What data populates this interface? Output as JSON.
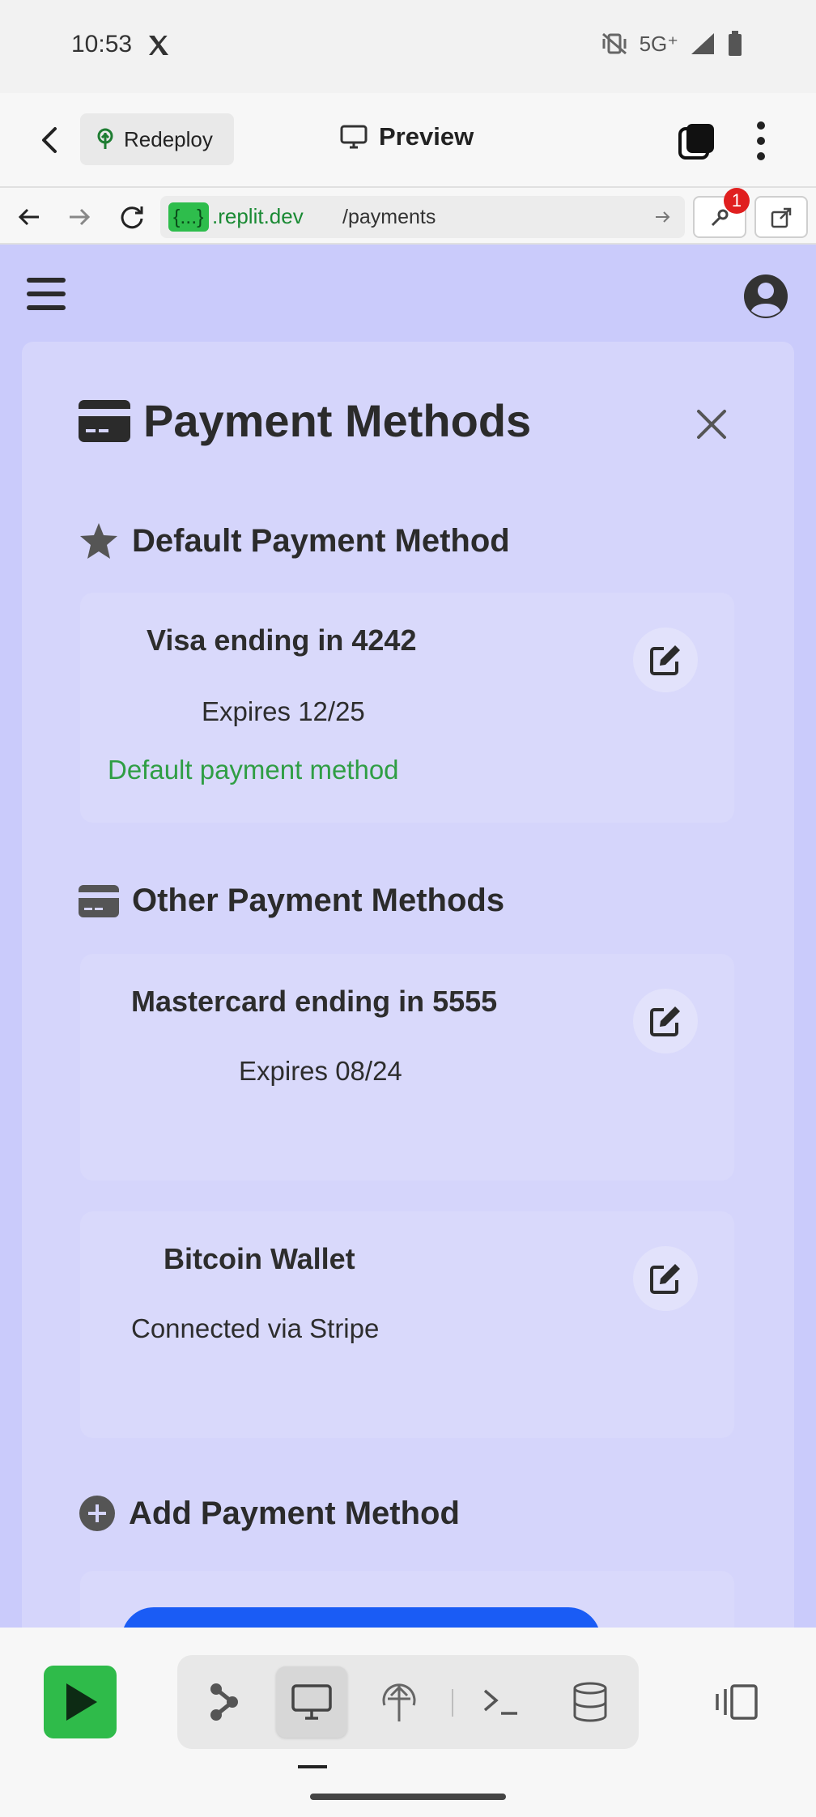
{
  "status_bar": {
    "time": "10:53",
    "network": "5G⁺"
  },
  "header": {
    "redeploy_label": "Redeploy",
    "preview_label": "Preview"
  },
  "browser": {
    "url_badge": "{...}",
    "url_host": ".replit.dev",
    "url_path": "/payments",
    "devtools_badge": "1"
  },
  "panel": {
    "title": "Payment Methods",
    "default_section": {
      "title": "Default Payment Method",
      "card": {
        "name": "Visa ending in 4242",
        "expires": "Expires 12/25",
        "default_label": "Default payment method"
      }
    },
    "other_section": {
      "title": "Other Payment Methods",
      "cards": [
        {
          "name": "Mastercard ending in 5555",
          "detail": "Expires 08/24"
        },
        {
          "name": "Bitcoin Wallet",
          "detail": "Connected via Stripe"
        }
      ]
    },
    "add_section": {
      "title": "Add Payment Method"
    }
  },
  "colors": {
    "page_bg": "#cacbfb",
    "panel_bg": "#d5d5fb",
    "default_green": "#2f9e44",
    "add_button_blue": "#1a5cf5",
    "run_green": "#2fbb4a"
  },
  "icons": {
    "panel_title": "credit-card-icon",
    "default_section": "star-icon",
    "other_section": "credit-card-icon",
    "add_section": "plus-circle-icon",
    "edit": "edit-icon",
    "close": "close-icon"
  }
}
